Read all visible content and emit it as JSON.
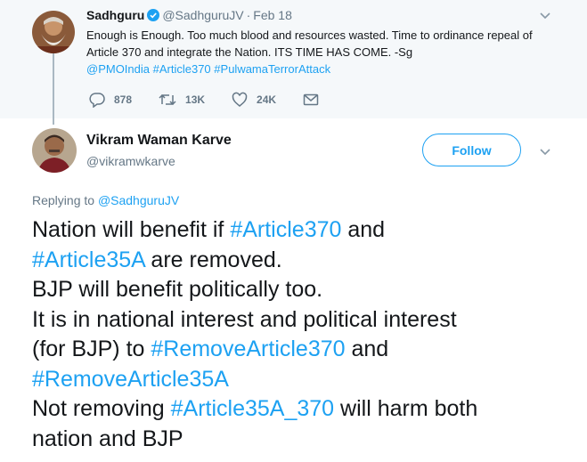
{
  "parent_tweet": {
    "name": "Sadhguru",
    "handle": "@SadhguruJV",
    "separator": "·",
    "date": "Feb 18",
    "text_plain": "Enough is Enough. Too much blood and resources wasted. Time to ordinance repeal of Article 370 and integrate the Nation. ITS TIME HAS COME. -Sg",
    "mention": "@PMOIndia",
    "hashtag_1": "#Article370",
    "hashtag_2": "#PulwamaTerrorAttack",
    "replies": "878",
    "retweets": "13K",
    "likes": "24K"
  },
  "reply_tweet": {
    "name": "Vikram Waman Karve",
    "handle": "@vikramwkarve",
    "follow_label": "Follow",
    "replying_prefix": "Replying to",
    "replying_to": "@SadhguruJV",
    "lines": {
      "t1": "Nation will benefit if ",
      "h1": "#Article370",
      "t2": " and",
      "h2": "#Article35A",
      "t3": " are removed.",
      "t4": "BJP will benefit politically too.",
      "t5": "It is in national interest and political interest",
      "t6": "(for BJP) to ",
      "h3": "#RemoveArticle370",
      "t7": " and",
      "h4": "#RemoveArticle35A",
      "t8": "Not removing ",
      "h5": "#Article35A_370",
      "t9": " will harm both",
      "t10": "nation and BJP"
    }
  },
  "colors": {
    "link": "#1da1f2",
    "muted": "#657786",
    "parent_bg": "#f5f8fa"
  }
}
